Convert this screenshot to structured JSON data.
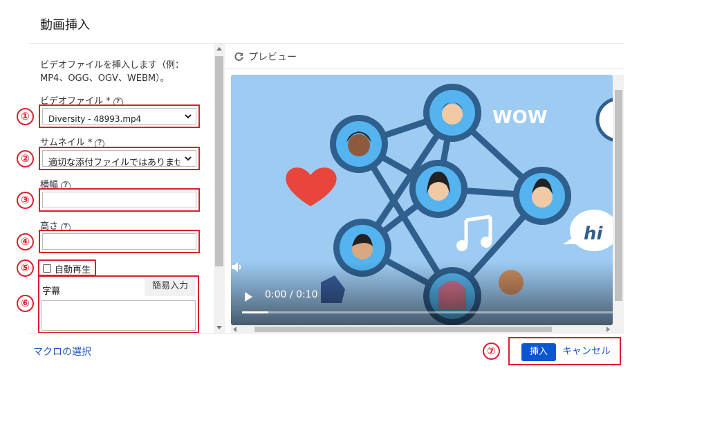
{
  "dialog": {
    "title": "動画挿入"
  },
  "form": {
    "description": "ビデオファイルを挿入します（例：MP4、OGG、OGV、WEBM）。",
    "video_file_label": "ビデオファイル *",
    "video_file_value": "Diversity - 48993.mp4",
    "thumbnail_label": "サムネイル *",
    "thumbnail_value": "適切な添付ファイルではありません",
    "width_label": "横幅",
    "height_label": "高さ",
    "autoplay_label": "自動再生",
    "subtitle_label": "字幕",
    "easy_input_label": "簡易入力",
    "help_glyph": "?"
  },
  "markers": [
    "①",
    "②",
    "③",
    "④",
    "⑤",
    "⑥",
    "⑦"
  ],
  "preview": {
    "title": "プレビュー",
    "time": "0:00 / 0:10",
    "progress": 0.07,
    "wow_text": "WOW",
    "hi_text": "hi"
  },
  "footer": {
    "macro_link": "マクロの選択",
    "insert_label": "挿入",
    "cancel_label": "キャンセル"
  },
  "colors": {
    "accent": "#0b56d0",
    "annotation": "#d9202c",
    "link": "#1b57c6"
  }
}
